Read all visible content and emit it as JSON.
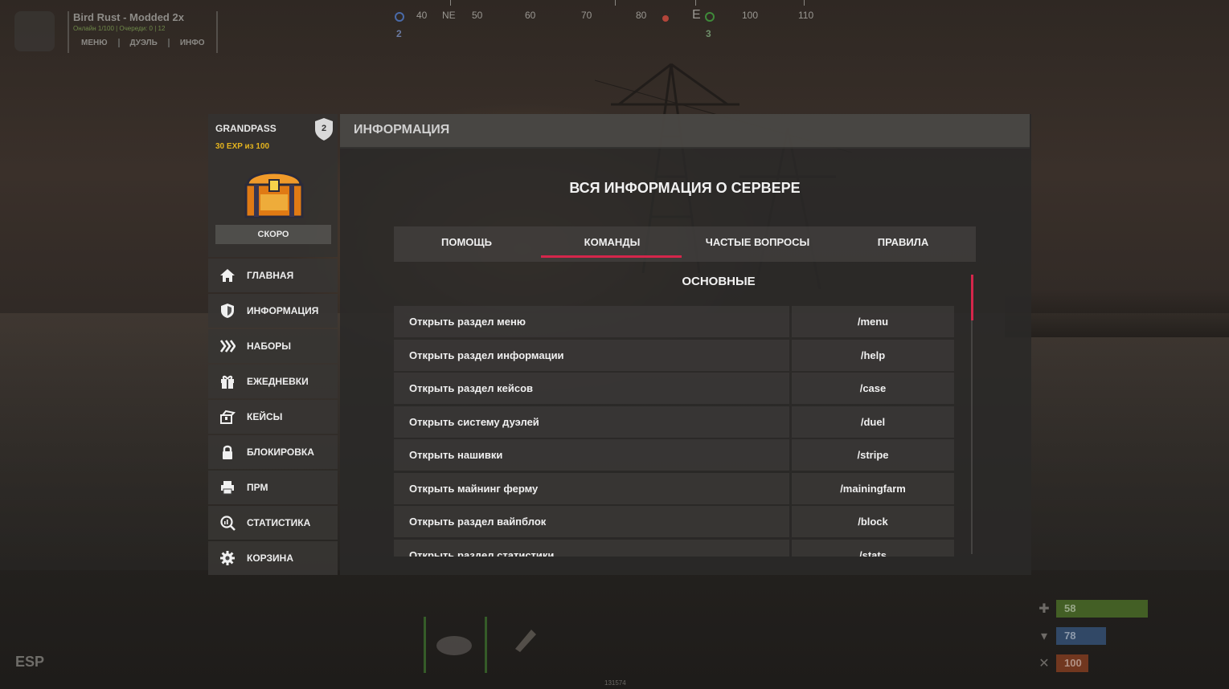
{
  "colors": {
    "accent": "#d5264b",
    "exp": "#e3b31f",
    "health": "#5a8a2b",
    "water": "#3a5f8f",
    "food": "#a84a23"
  },
  "hud": {
    "server": {
      "title": "Bird Rust - Modded 2x",
      "stats": "Онлайн 1/100 | Очереди: 0 | 12",
      "links": [
        "МЕНЮ",
        "ДУЭЛЬ",
        "ИНФО"
      ]
    },
    "compass": {
      "labels": [
        "40",
        "NE",
        "50",
        "60",
        "70",
        "80",
        "E",
        "100",
        "110"
      ],
      "markers": [
        "2",
        "3"
      ]
    },
    "esp_label": "ESP",
    "coords": "131574",
    "vitals": {
      "health": "58",
      "water": "78",
      "food": "100"
    }
  },
  "sidebar": {
    "pass_title": "GRANDPASS",
    "pass_level": "2",
    "pass_exp": "30 EXP из 100",
    "soon_label": "СКОРО",
    "items": [
      {
        "label": "ГЛАВНАЯ",
        "icon": "home-icon"
      },
      {
        "label": "ИНФОРМАЦИЯ",
        "icon": "shield-icon"
      },
      {
        "label": "НАБОРЫ",
        "icon": "kits-icon"
      },
      {
        "label": "ЕЖЕДНЕВКИ",
        "icon": "gift-icon"
      },
      {
        "label": "КЕЙСЫ",
        "icon": "case-icon"
      },
      {
        "label": "БЛОКИРОВКА",
        "icon": "lock-icon"
      },
      {
        "label": "ПРМ",
        "icon": "printer-icon"
      },
      {
        "label": "СТАТИСТИКА",
        "icon": "stats-search-icon"
      },
      {
        "label": "КОРЗИНА",
        "icon": "gear-icon"
      }
    ]
  },
  "panel": {
    "title": "ИНФОРМАЦИЯ",
    "heading": "ВСЯ ИНФОРМАЦИЯ О СЕРВЕРЕ",
    "tabs": [
      {
        "label": "ПОМОЩЬ",
        "active": false
      },
      {
        "label": "КОМАНДЫ",
        "active": true
      },
      {
        "label": "ЧАСТЫЕ ВОПРОСЫ",
        "active": false
      },
      {
        "label": "ПРАВИЛА",
        "active": false
      }
    ],
    "subheading": "ОСНОВНЫЕ",
    "commands": [
      {
        "desc": "Открыть раздел меню",
        "cmd": "/menu"
      },
      {
        "desc": "Открыть раздел информации",
        "cmd": "/help"
      },
      {
        "desc": "Открыть раздел кейсов",
        "cmd": "/case"
      },
      {
        "desc": "Открыть систему дуэлей",
        "cmd": "/duel"
      },
      {
        "desc": "Открыть нашивки",
        "cmd": "/stripe"
      },
      {
        "desc": "Открыть майнинг ферму",
        "cmd": "/mainingfarm"
      },
      {
        "desc": "Открыть раздел вайпблок",
        "cmd": "/block"
      },
      {
        "desc": "Открыть раздел статистики",
        "cmd": "/stats"
      }
    ]
  }
}
